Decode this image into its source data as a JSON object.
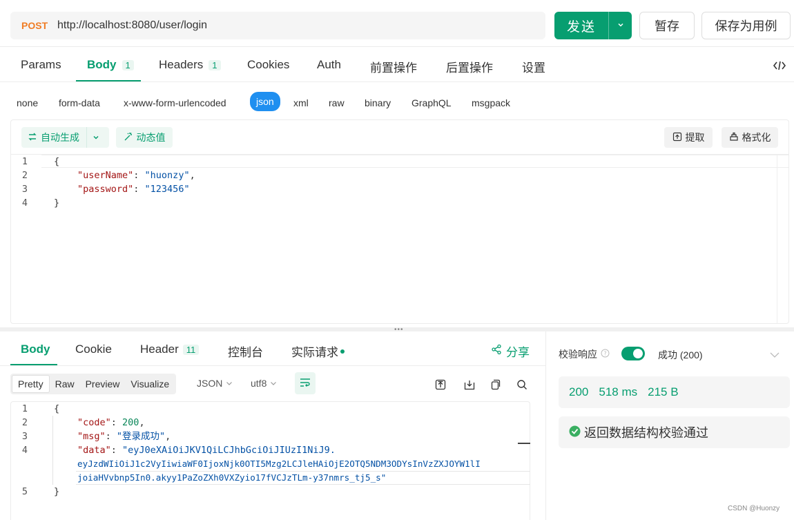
{
  "request": {
    "method": "POST",
    "url": "http://localhost:8080/user/login",
    "send_label": "发送",
    "save_draft_label": "暂存",
    "save_case_label": "保存为用例"
  },
  "req_tabs": [
    {
      "label": "Params"
    },
    {
      "label": "Body",
      "count": "1"
    },
    {
      "label": "Headers",
      "count": "1"
    },
    {
      "label": "Cookies"
    },
    {
      "label": "Auth"
    },
    {
      "label": "前置操作"
    },
    {
      "label": "后置操作"
    },
    {
      "label": "设置"
    }
  ],
  "code_toggle_icon": "code-icon",
  "body_types": [
    "none",
    "form-data",
    "x-www-form-urlencoded",
    "json",
    "xml",
    "raw",
    "binary",
    "GraphQL",
    "msgpack"
  ],
  "selected_body_type": "json",
  "editor_toolbar": {
    "auto_generate": "自动生成",
    "dynamic_value": "动态值",
    "extract": "提取",
    "format": "格式化"
  },
  "request_body": {
    "line_numbers": [
      "1",
      "2",
      "3",
      "4"
    ],
    "open": "{",
    "k1": "\"userName\"",
    "v1": "\"huonzy\"",
    "k2": "\"password\"",
    "v2": "\"123456\"",
    "close": "}"
  },
  "resp_tabs": [
    {
      "label": "Body"
    },
    {
      "label": "Cookie"
    },
    {
      "label": "Header",
      "count": "11"
    },
    {
      "label": "控制台"
    },
    {
      "label": "实际请求"
    }
  ],
  "share_label": "分享",
  "view_modes": [
    "Pretty",
    "Raw",
    "Preview",
    "Visualize"
  ],
  "selected_view_mode": "Pretty",
  "format_select": "JSON",
  "encoding_select": "utf8",
  "response_body": {
    "line_numbers": [
      "1",
      "2",
      "3",
      "4",
      "5"
    ],
    "open": "{",
    "k_code": "\"code\"",
    "v_code": "200",
    "k_msg": "\"msg\"",
    "v_msg": "\"登录成功\"",
    "k_data": "\"data\"",
    "v_data_1": "\"eyJ0eXAiOiJKV1QiLCJhbGciOiJIUzI1NiJ9.",
    "v_data_2": "eyJzdWIiOiJ1c2VyIiwiaWF0IjoxNjk0OTI5Mzg2LCJleHAiOjE2OTQ5NDM3ODYsInVzZXJOYW1lI",
    "v_data_3": "joiaHVvbnp5In0.akyy1PaZoZXh0VXZyio17fVCJzTLm-y37nmrs_tj5_s\"",
    "close": "}"
  },
  "validation": {
    "label": "校验响应",
    "toggle_on": true,
    "status": "成功 (200)",
    "code": "200",
    "time": "518 ms",
    "size": "215 B",
    "result": "返回数据结构校验通过"
  },
  "watermark": "CSDN @Huonzy",
  "colors": {
    "accent": "#079e70",
    "method": "#f07c24",
    "selected_type": "#1f8ff0"
  }
}
